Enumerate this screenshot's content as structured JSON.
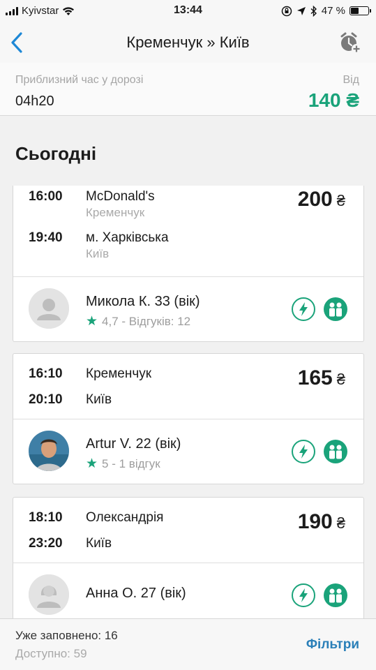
{
  "status_bar": {
    "carrier": "Kyivstar",
    "time": "13:44",
    "battery": "47 %",
    "battery_level": 0.47
  },
  "nav": {
    "title": "Кременчук » Київ",
    "back_icon": "chevron-left-icon",
    "alarm_icon": "alarm-add-icon"
  },
  "summary": {
    "travel_time_label": "Приблизний час у дорозі",
    "travel_time_value": "04h20",
    "price_from_label": "Від",
    "price_from_value": "140 ₴"
  },
  "section": {
    "title": "Сьогодні"
  },
  "trips": [
    {
      "depart_time": "16:00",
      "depart_place": "McDonald's",
      "depart_city": "Кременчук",
      "arrive_time": "19:40",
      "arrive_place": "м. Харківська",
      "arrive_city": "Київ",
      "price": "200",
      "currency": "₴",
      "driver": {
        "name": "Микола К. 33 (вік)",
        "rating": "4,7 - Відгуків: 12",
        "avatar": "placeholder"
      }
    },
    {
      "depart_time": "16:10",
      "depart_place": "Кременчук",
      "arrive_time": "20:10",
      "arrive_place": "Київ",
      "price": "165",
      "currency": "₴",
      "driver": {
        "name": "Artur V. 22 (вік)",
        "rating": "5 - 1 відгук",
        "avatar": "photo"
      }
    },
    {
      "depart_time": "18:10",
      "depart_place": "Олександрія",
      "arrive_time": "23:20",
      "arrive_place": "Київ",
      "price": "190",
      "currency": "₴",
      "driver": {
        "name": "Анна О. 27 (вік)",
        "rating": "",
        "avatar": "placeholder-female"
      }
    }
  ],
  "footer": {
    "filled": "Уже заповнено: 16",
    "available": "Доступно: 59",
    "filters_label": "Фільтри"
  },
  "colors": {
    "accent_green": "#1aa37a",
    "link_blue": "#2a7fb8",
    "nav_blue": "#1e88d6"
  }
}
